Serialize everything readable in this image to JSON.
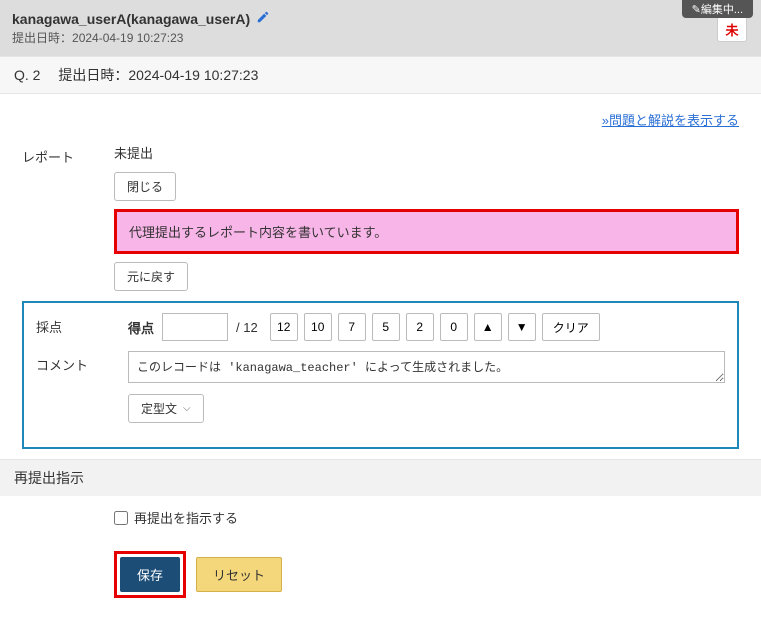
{
  "editing_indicator": "✎編集中...",
  "header": {
    "user_display": "kanagawa_userA(kanagawa_userA)",
    "submit_label": "提出日時：",
    "submit_time": "2024-04-19 10:27:23",
    "status_badge": "未"
  },
  "qbar": {
    "qnum": "Q. 2",
    "submit_label": "提出日時：",
    "submit_time": "2024-04-19 10:27:23"
  },
  "link_show_explanation": "»問題と解説を表示する",
  "report": {
    "label": "レポート",
    "status": "未提出",
    "close_btn": "閉じる",
    "content": "代理提出するレポート内容を書いています。",
    "revert_btn": "元に戻す"
  },
  "grading": {
    "label": "採点",
    "score_label": "得点",
    "score_value": "",
    "max": "/ 12",
    "presets": [
      "12",
      "10",
      "7",
      "5",
      "2",
      "0"
    ],
    "arrow_up": "▲",
    "arrow_down": "▼",
    "clear_btn": "クリア"
  },
  "comment": {
    "label": "コメント",
    "value": "このレコードは 'kanagawa_teacher' によって生成されました。",
    "template_btn": "定型文"
  },
  "resubmit": {
    "section_title": "再提出指示",
    "checkbox_label": "再提出を指示する",
    "checked": false
  },
  "actions": {
    "save": "保存",
    "reset": "リセット"
  }
}
